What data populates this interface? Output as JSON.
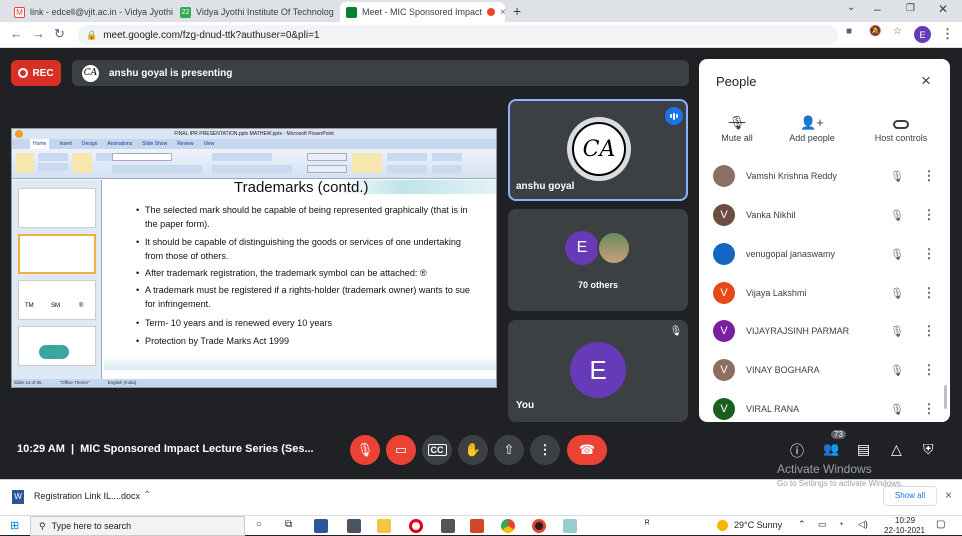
{
  "browser": {
    "tabs": [
      {
        "label": "link - edcell@vjit.ac.in - Vidya Jyothi",
        "close": "×"
      },
      {
        "label": "Vidya Jyothi Institute Of Technolog",
        "close": "×"
      },
      {
        "label": "Meet - MIC Sponsored Impact",
        "close": "×"
      }
    ],
    "new_tab": "+",
    "url": "meet.google.com/fzg-dnud-ttk?authuser=0&pli=1",
    "profile_initial": "E"
  },
  "meet": {
    "rec_label": "REC",
    "presenting_text": "anshu goyal is presenting",
    "presenter_initials": "CA",
    "tiles": {
      "presenter": {
        "name": "anshu goyal",
        "initials": "CA"
      },
      "others": {
        "avatar_initial": "E",
        "label": "70 others"
      },
      "self": {
        "initial": "E",
        "label": "You"
      }
    },
    "time": "10:29 AM",
    "meeting_title": "MIC Sponsored Impact Lecture Series (Ses...",
    "participant_count": "73",
    "accent_red": "#ea4335",
    "accent_blue": "#8ab4f8"
  },
  "slide": {
    "window_title": "FINAL IPR PRESENTATION.pptx MATHEW.pptx - Microsoft PowerPoint",
    "ribbon_tabs": [
      "Home",
      "Insert",
      "Design",
      "Animations",
      "Slide Show",
      "Review",
      "View"
    ],
    "heading": "Trademarks (contd.)",
    "bullets": [
      "The selected mark should be capable of being represented graphically (that is in",
      "the paper form).",
      "It should be capable of distinguishing the goods or services of one undertaking",
      "from those of others.",
      "After trademark registration, the trademark symbol can be attached: ®",
      "A trademark must be registered if a rights-holder (trademark owner) wants to sue",
      "for infringement.",
      "Term- 10 years and is renewed every 10 years",
      "Protection by Trade Marks Act 1999"
    ],
    "status_left": "Slide 14 of 65",
    "status_theme": "\"Office Theme\"",
    "status_lang": "English (India)",
    "thumb_labels": [
      "TM",
      "SM",
      "®"
    ]
  },
  "people_panel": {
    "title": "People",
    "close": "×",
    "actions": [
      "Mute all",
      "Add people",
      "Host controls"
    ],
    "participants": [
      {
        "name": "Vamshi Krishna Reddy",
        "initial": "",
        "color": "#8d6e63"
      },
      {
        "name": "Vanka Nikhil",
        "initial": "V",
        "color": "#6d4c41"
      },
      {
        "name": "venugopal janaswamy",
        "initial": "",
        "color": "#1565c0"
      },
      {
        "name": "Vijaya Lakshmi",
        "initial": "V",
        "color": "#e64a19"
      },
      {
        "name": "VIJAYRAJSINH PARMAR",
        "initial": "V",
        "color": "#7b1fa2"
      },
      {
        "name": "VINAY BOGHARA",
        "initial": "V",
        "color": "#8d6e63"
      },
      {
        "name": "VIRAL RANA",
        "initial": "V",
        "color": "#1b5e20"
      }
    ]
  },
  "watermark": {
    "title": "Activate Windows",
    "subtitle": "Go to Settings to activate Windows."
  },
  "download": {
    "file": "Registration Link IL....docx",
    "show_all": "Show all",
    "close": "×"
  },
  "taskbar": {
    "search_placeholder": "Type here to search",
    "weather": "29°C  Sunny",
    "clock_time": "10:29",
    "clock_date": "22-10-2021"
  }
}
